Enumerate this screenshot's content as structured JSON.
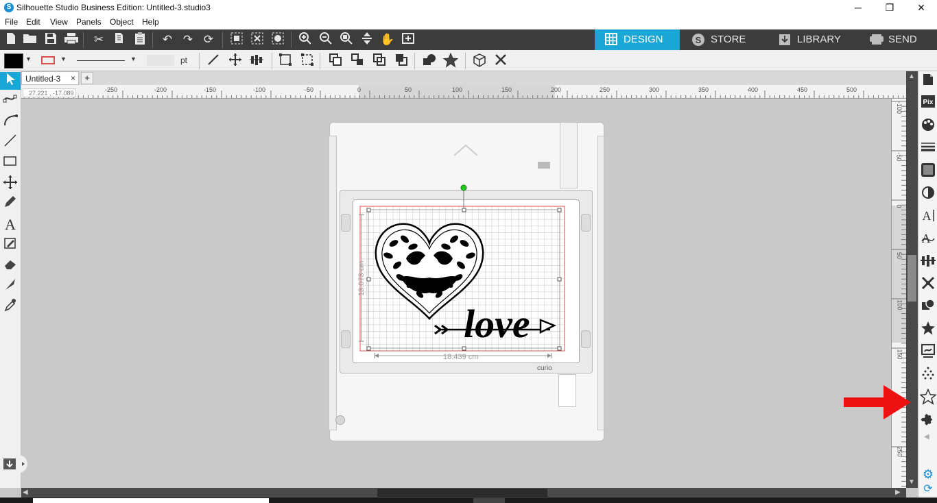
{
  "window": {
    "title": "Silhouette Studio Business Edition: Untitled-3.studio3",
    "minimize": "─",
    "restore": "❐",
    "close": "✕"
  },
  "menu": [
    "File",
    "Edit",
    "View",
    "Panels",
    "Object",
    "Help"
  ],
  "main_tabs": [
    {
      "label": "DESIGN",
      "icon": "grid-icon",
      "active": true
    },
    {
      "label": "STORE",
      "icon": "silhouette-s-icon",
      "active": false
    },
    {
      "label": "LIBRARY",
      "icon": "download-library-icon",
      "active": false
    },
    {
      "label": "SEND",
      "icon": "cutter-send-icon",
      "active": false
    }
  ],
  "toolbar2": {
    "line_unit": "pt"
  },
  "doc_tab": {
    "name": "Untitled-3",
    "close": "×",
    "add": "+"
  },
  "ruler": {
    "coord_readout": "27.221 , -17.089",
    "h_labels": [
      "-250",
      "-200",
      "-150",
      "-100",
      "-50",
      "0",
      "50",
      "100",
      "150",
      "200",
      "250",
      "300",
      "350",
      "400",
      "450",
      "500"
    ],
    "v_labels": [
      "-100",
      "-50",
      "0",
      "50",
      "100",
      "150",
      "200",
      "250"
    ]
  },
  "canvas": {
    "width_dim": "18.439 cm",
    "height_dim": "13.073 cm",
    "machine_brand": "curio",
    "design_text": "love"
  },
  "colors": {
    "accent": "#1aa7d6",
    "toolbar_dark": "#3c3c3c",
    "cut_line": "#e05050",
    "arrow": "#ee1111",
    "rotate_handle": "#22cc22"
  }
}
